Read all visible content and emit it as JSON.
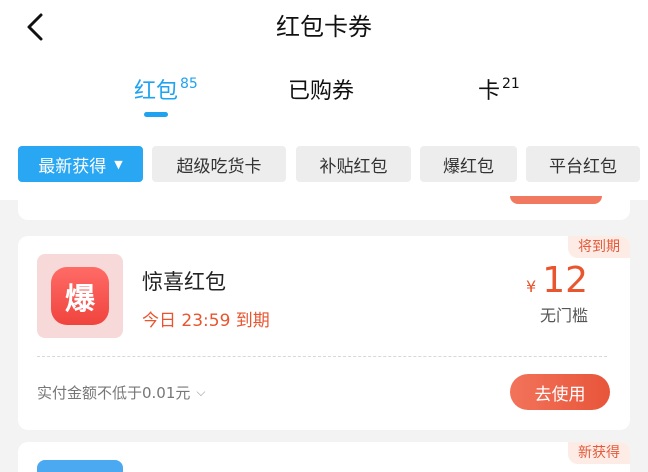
{
  "header": {
    "title": "红包卡券"
  },
  "tabs": [
    {
      "label": "红包",
      "count": "85"
    },
    {
      "label": "已购券",
      "count": ""
    },
    {
      "label": "卡",
      "count": "21"
    }
  ],
  "filters": {
    "active_label": "最新获得",
    "items": [
      "超级吃货卡",
      "补贴红包",
      "爆红包",
      "平台红包"
    ]
  },
  "coupon": {
    "badge": "将到期",
    "logo_char": "爆",
    "name": "惊喜红包",
    "expire": "今日 23:59 到期",
    "currency": "¥",
    "amount": "12",
    "threshold": "无门槛",
    "rule": "实付金额不低于0.01元",
    "action": "去使用"
  },
  "next_coupon": {
    "badge": "新获得"
  },
  "colors": {
    "accent_blue": "#1fa3f0",
    "accent_red": "#e8552f"
  }
}
